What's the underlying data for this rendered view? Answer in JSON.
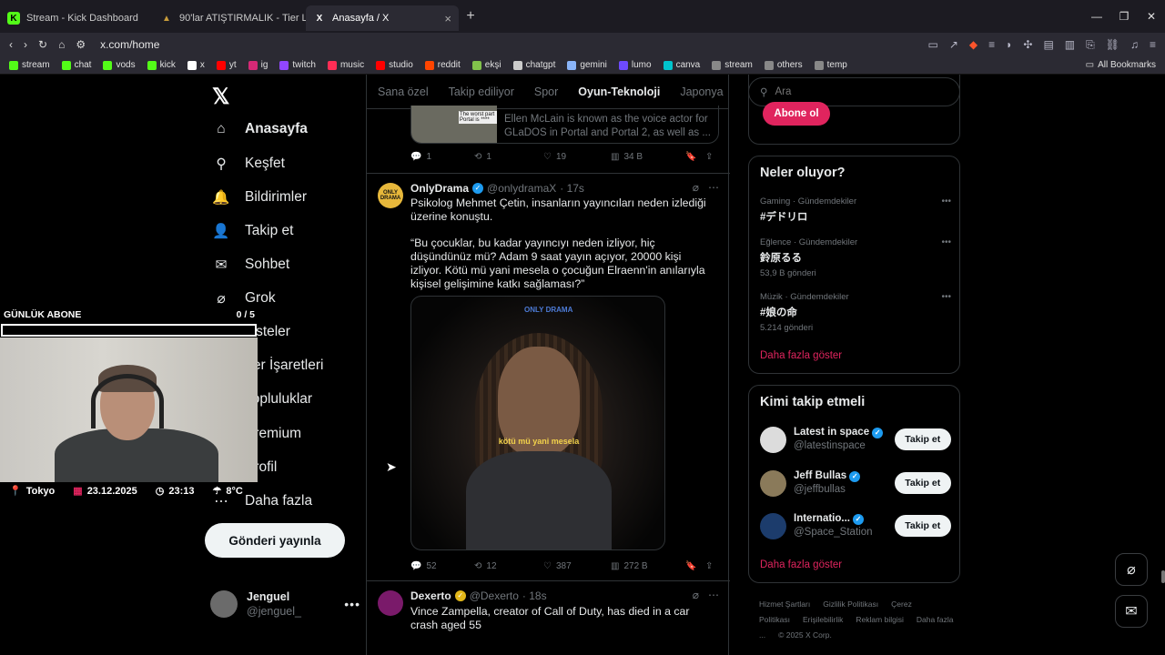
{
  "browser": {
    "tabs": [
      {
        "title": "Stream - Kick Dashboard",
        "fav_color": "#53fc18",
        "fav_letter": "K"
      },
      {
        "title": "90'lar ATIŞTIRMALIK - Tier List, Kör Sı",
        "fav_color": "#c79b3b",
        "fav_letter": "▲"
      },
      {
        "title": "Anasayfa / X",
        "fav_color": "#ffffff",
        "fav_letter": "X"
      }
    ],
    "new_tab": "+",
    "url": "x.com/home",
    "bookmarks": [
      {
        "label": "stream",
        "color": "#53fc18"
      },
      {
        "label": "chat",
        "color": "#53fc18"
      },
      {
        "label": "vods",
        "color": "#53fc18"
      },
      {
        "label": "kick",
        "color": "#53fc18"
      },
      {
        "label": "x",
        "color": "#ffffff"
      },
      {
        "label": "yt",
        "color": "#ff0000"
      },
      {
        "label": "ig",
        "color": "#d62976"
      },
      {
        "label": "twitch",
        "color": "#9146ff"
      },
      {
        "label": "music",
        "color": "#ff2d55"
      },
      {
        "label": "studio",
        "color": "#ff0000"
      },
      {
        "label": "reddit",
        "color": "#ff4500"
      },
      {
        "label": "ekşi",
        "color": "#81c14b"
      },
      {
        "label": "chatgpt",
        "color": "#cccccc"
      },
      {
        "label": "gemini",
        "color": "#8ab4f8"
      },
      {
        "label": "lumo",
        "color": "#6d4aff"
      },
      {
        "label": "canva",
        "color": "#00c4cc"
      },
      {
        "label": "stream",
        "color": "#888888"
      },
      {
        "label": "others",
        "color": "#888888"
      },
      {
        "label": "temp",
        "color": "#888888"
      }
    ],
    "all_bookmarks": "All Bookmarks"
  },
  "nav": {
    "items": [
      {
        "label": "Anasayfa",
        "icon": "home-icon",
        "glyph": "⌂"
      },
      {
        "label": "Keşfet",
        "icon": "search-icon",
        "glyph": "⚲"
      },
      {
        "label": "Bildirimler",
        "icon": "bell-icon",
        "glyph": "🔔"
      },
      {
        "label": "Takip et",
        "icon": "follow-icon",
        "glyph": "👤"
      },
      {
        "label": "Sohbet",
        "icon": "mail-icon",
        "glyph": "✉"
      },
      {
        "label": "Grok",
        "icon": "grok-icon",
        "glyph": "⌀"
      },
      {
        "label": "Listeler",
        "icon": "list-icon",
        "glyph": "☰"
      },
      {
        "label": "Yer İşaretleri",
        "icon": "bookmark-icon",
        "glyph": "🔖"
      },
      {
        "label": "Topluluklar",
        "icon": "communities-icon",
        "glyph": "👥"
      },
      {
        "label": "Premium",
        "icon": "premium-icon",
        "glyph": "✕"
      },
      {
        "label": "Profil",
        "icon": "profile-icon",
        "glyph": "👤"
      },
      {
        "label": "Daha fazla",
        "icon": "more-icon",
        "glyph": "⋯"
      }
    ],
    "post_button": "Gönderi yayınla",
    "account": {
      "name": "Jenguel",
      "handle": "@jenguel_",
      "more": "•••"
    }
  },
  "feed": {
    "tabs": [
      "Sana özel",
      "Takip ediliyor",
      "Spor",
      "Oyun-Teknoloji",
      "Japonya"
    ],
    "selected_tab": "Oyun-Teknoloji",
    "prev_card_text": "Ellen McLain is known as the voice actor for GLaDOS in Portal and Portal 2, as well as ...",
    "prev_card_thumb_text": "The worst part Portal is ****",
    "prev_actions": {
      "replies": "1",
      "reposts": "1",
      "likes": "19",
      "views": "34 B"
    },
    "tweet1": {
      "name": "OnlyDrama",
      "handle": "@onlydramaX",
      "time": "· 17s",
      "avatar_text": "ONLY DRAMA",
      "text1": "Psikolog Mehmet Çetin, insanların yayıncıları neden izlediği üzerine konuştu.",
      "text2": "“Bu çocuklar, bu kadar yayıncıyı neden izliyor, hiç düşündünüz mü? Adam 9 saat yayın açıyor, 20000 kişi izliyor. Kötü mü yani mesela o çocuğun Elraenn'in anılarıyla kişisel gelişimine katkı sağlaması?”",
      "media_watermark": "ONLY DRAMA",
      "media_caption": "kötü mü yani mesela",
      "actions": {
        "replies": "52",
        "reposts": "12",
        "likes": "387",
        "views": "272 B"
      }
    },
    "tweet2": {
      "name": "Dexerto",
      "handle": "@Dexerto",
      "time": "· 18s",
      "text": "Vince Zampella, creator of Call of Duty, has died in a car crash aged 55"
    }
  },
  "right": {
    "search_placeholder": "Ara",
    "subscribe_button": "Abone ol",
    "trends_title": "Neler oluyor?",
    "trends": [
      {
        "meta": "Gaming · Gündemdekiler",
        "name": "#デドリロ",
        "count": ""
      },
      {
        "meta": "Eğlence · Gündemdekiler",
        "name": "鈴原るる",
        "count": "53,9 B gönderi"
      },
      {
        "meta": "Müzik · Gündemdekiler",
        "name": "#娘の命",
        "count": "5.214 gönderi"
      }
    ],
    "show_more": "Daha fazla göster",
    "who_title": "Kimi takip etmeli",
    "who": [
      {
        "name": "Latest in space",
        "handle": "@latestinspace",
        "color": "#dcdcdc"
      },
      {
        "name": "Jeff Bullas",
        "handle": "@jeffbullas",
        "color": "#8a7a5a"
      },
      {
        "name": "Internatio...",
        "handle": "@Space_Station",
        "color": "#1c3c6c"
      }
    ],
    "follow_label": "Takip et",
    "footer": [
      "Hizmet Şartları",
      "Gizlilik Politikası",
      "Çerez Politikası",
      "Erişilebilirlik",
      "Reklam bilgisi",
      "Daha fazla ...",
      "© 2025 X Corp."
    ]
  },
  "overlay": {
    "label": "GÜNLÜK ABONE",
    "progress": "0 / 5",
    "progress_fraction": 0,
    "location": "Tokyo",
    "date": "23.12.2025",
    "time": "23:13",
    "temperature": "8°C"
  },
  "colors": {
    "accent_pink": "#e0245e",
    "verified_blue": "#1d9bf0",
    "verified_gold": "#e2b719"
  }
}
